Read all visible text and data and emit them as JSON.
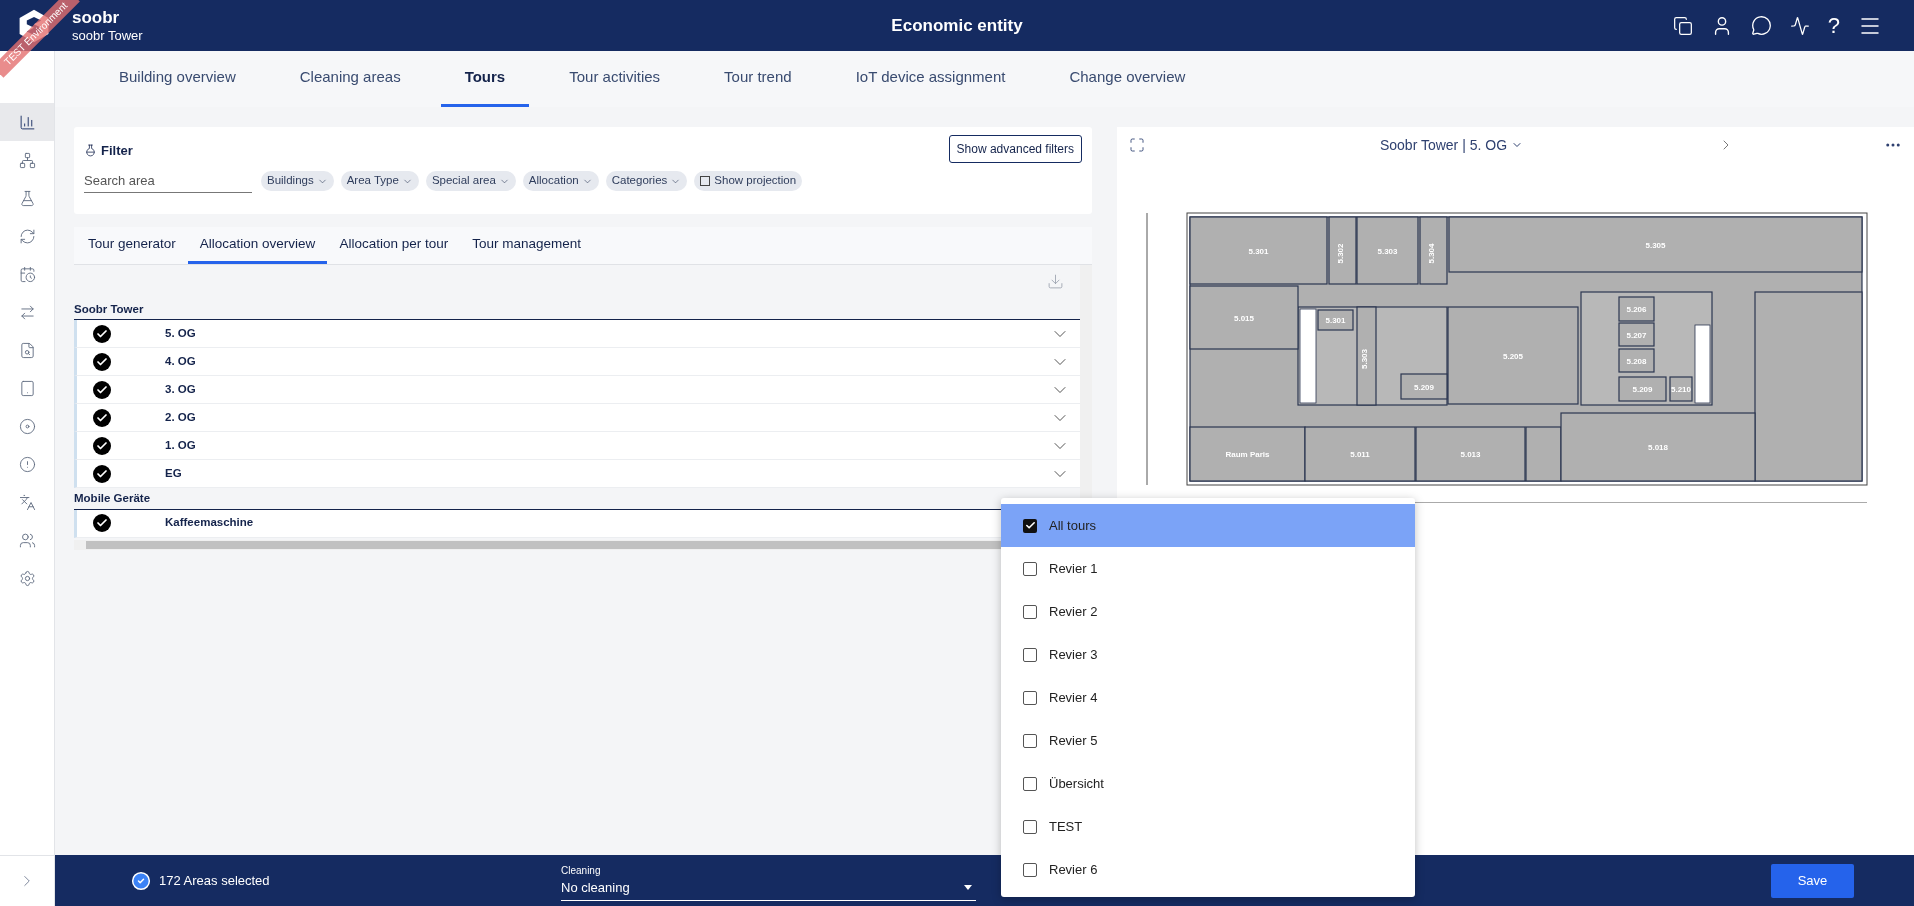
{
  "header": {
    "brand": "soobr",
    "building": "soobr Tower",
    "title": "Economic entity",
    "ribbon": "TEST Environment",
    "help_glyph": "?"
  },
  "sidebar": {
    "items": [
      {
        "selected": true
      },
      {
        "selected": false
      },
      {
        "selected": false
      },
      {
        "selected": false
      },
      {
        "selected": false
      },
      {
        "selected": false
      },
      {
        "selected": false
      },
      {
        "selected": false
      },
      {
        "selected": false
      },
      {
        "selected": false
      },
      {
        "selected": false
      },
      {
        "selected": false
      },
      {
        "selected": false
      }
    ]
  },
  "tabs": [
    {
      "label": "Building overview",
      "selected": false
    },
    {
      "label": "Cleaning areas",
      "selected": false
    },
    {
      "label": "Tours",
      "selected": true
    },
    {
      "label": "Tour activities",
      "selected": false
    },
    {
      "label": "Tour trend",
      "selected": false
    },
    {
      "label": "IoT device assignment",
      "selected": false
    },
    {
      "label": "Change overview",
      "selected": false
    }
  ],
  "filter": {
    "title": "Filter",
    "advanced_button": "Show advanced filters",
    "search": {
      "placeholder": "Search area"
    },
    "chips": [
      {
        "kind": "dropdown",
        "label": "Buildings"
      },
      {
        "kind": "dropdown",
        "label": "Area Type"
      },
      {
        "kind": "dropdown",
        "label": "Special area"
      },
      {
        "kind": "dropdown",
        "label": "Allocation"
      },
      {
        "kind": "dropdown",
        "label": "Categories"
      },
      {
        "kind": "checkbox",
        "label": "Show projection",
        "checked": false
      }
    ]
  },
  "subtabs": [
    {
      "label": "Tour generator",
      "selected": false
    },
    {
      "label": "Allocation overview",
      "selected": true
    },
    {
      "label": "Allocation per tour",
      "selected": false
    },
    {
      "label": "Tour management",
      "selected": false
    }
  ],
  "groups": [
    {
      "name": "Soobr Tower",
      "items": [
        {
          "label": "5. OG",
          "checked": true
        },
        {
          "label": "4. OG",
          "checked": true
        },
        {
          "label": "3. OG",
          "checked": true
        },
        {
          "label": "2. OG",
          "checked": true
        },
        {
          "label": "1. OG",
          "checked": true
        },
        {
          "label": "EG",
          "checked": true
        }
      ]
    },
    {
      "name": "Mobile Geräte",
      "items": [
        {
          "label": "Kaffeemaschine",
          "checked": true
        }
      ]
    }
  ],
  "plan": {
    "title": "Soobr Tower | 5. OG",
    "rooms": [
      "5.301",
      "5.302",
      "5.303",
      "5.304",
      "5.305",
      "5.015",
      "5.301",
      "5.303",
      "5.205",
      "5.206",
      "5.207",
      "5.208",
      "5.209",
      "5.210",
      "5.209",
      "Raum Paris",
      "5.011",
      "5.013",
      "5.018"
    ]
  },
  "tour_menu": {
    "options": [
      {
        "label": "All tours",
        "checked": true,
        "selected": true
      },
      {
        "label": "Revier 1",
        "checked": false,
        "selected": false
      },
      {
        "label": "Revier 2",
        "checked": false,
        "selected": false
      },
      {
        "label": "Revier 3",
        "checked": false,
        "selected": false
      },
      {
        "label": "Revier 4",
        "checked": false,
        "selected": false
      },
      {
        "label": "Revier 5",
        "checked": false,
        "selected": false
      },
      {
        "label": "Übersicht",
        "checked": false,
        "selected": false
      },
      {
        "label": "TEST",
        "checked": false,
        "selected": false
      },
      {
        "label": "Revier 6",
        "checked": false,
        "selected": false
      }
    ]
  },
  "footer": {
    "selected_count": "172 Areas selected",
    "cleaning_label": "Cleaning",
    "cleaning_value": "No cleaning",
    "save": "Save"
  }
}
